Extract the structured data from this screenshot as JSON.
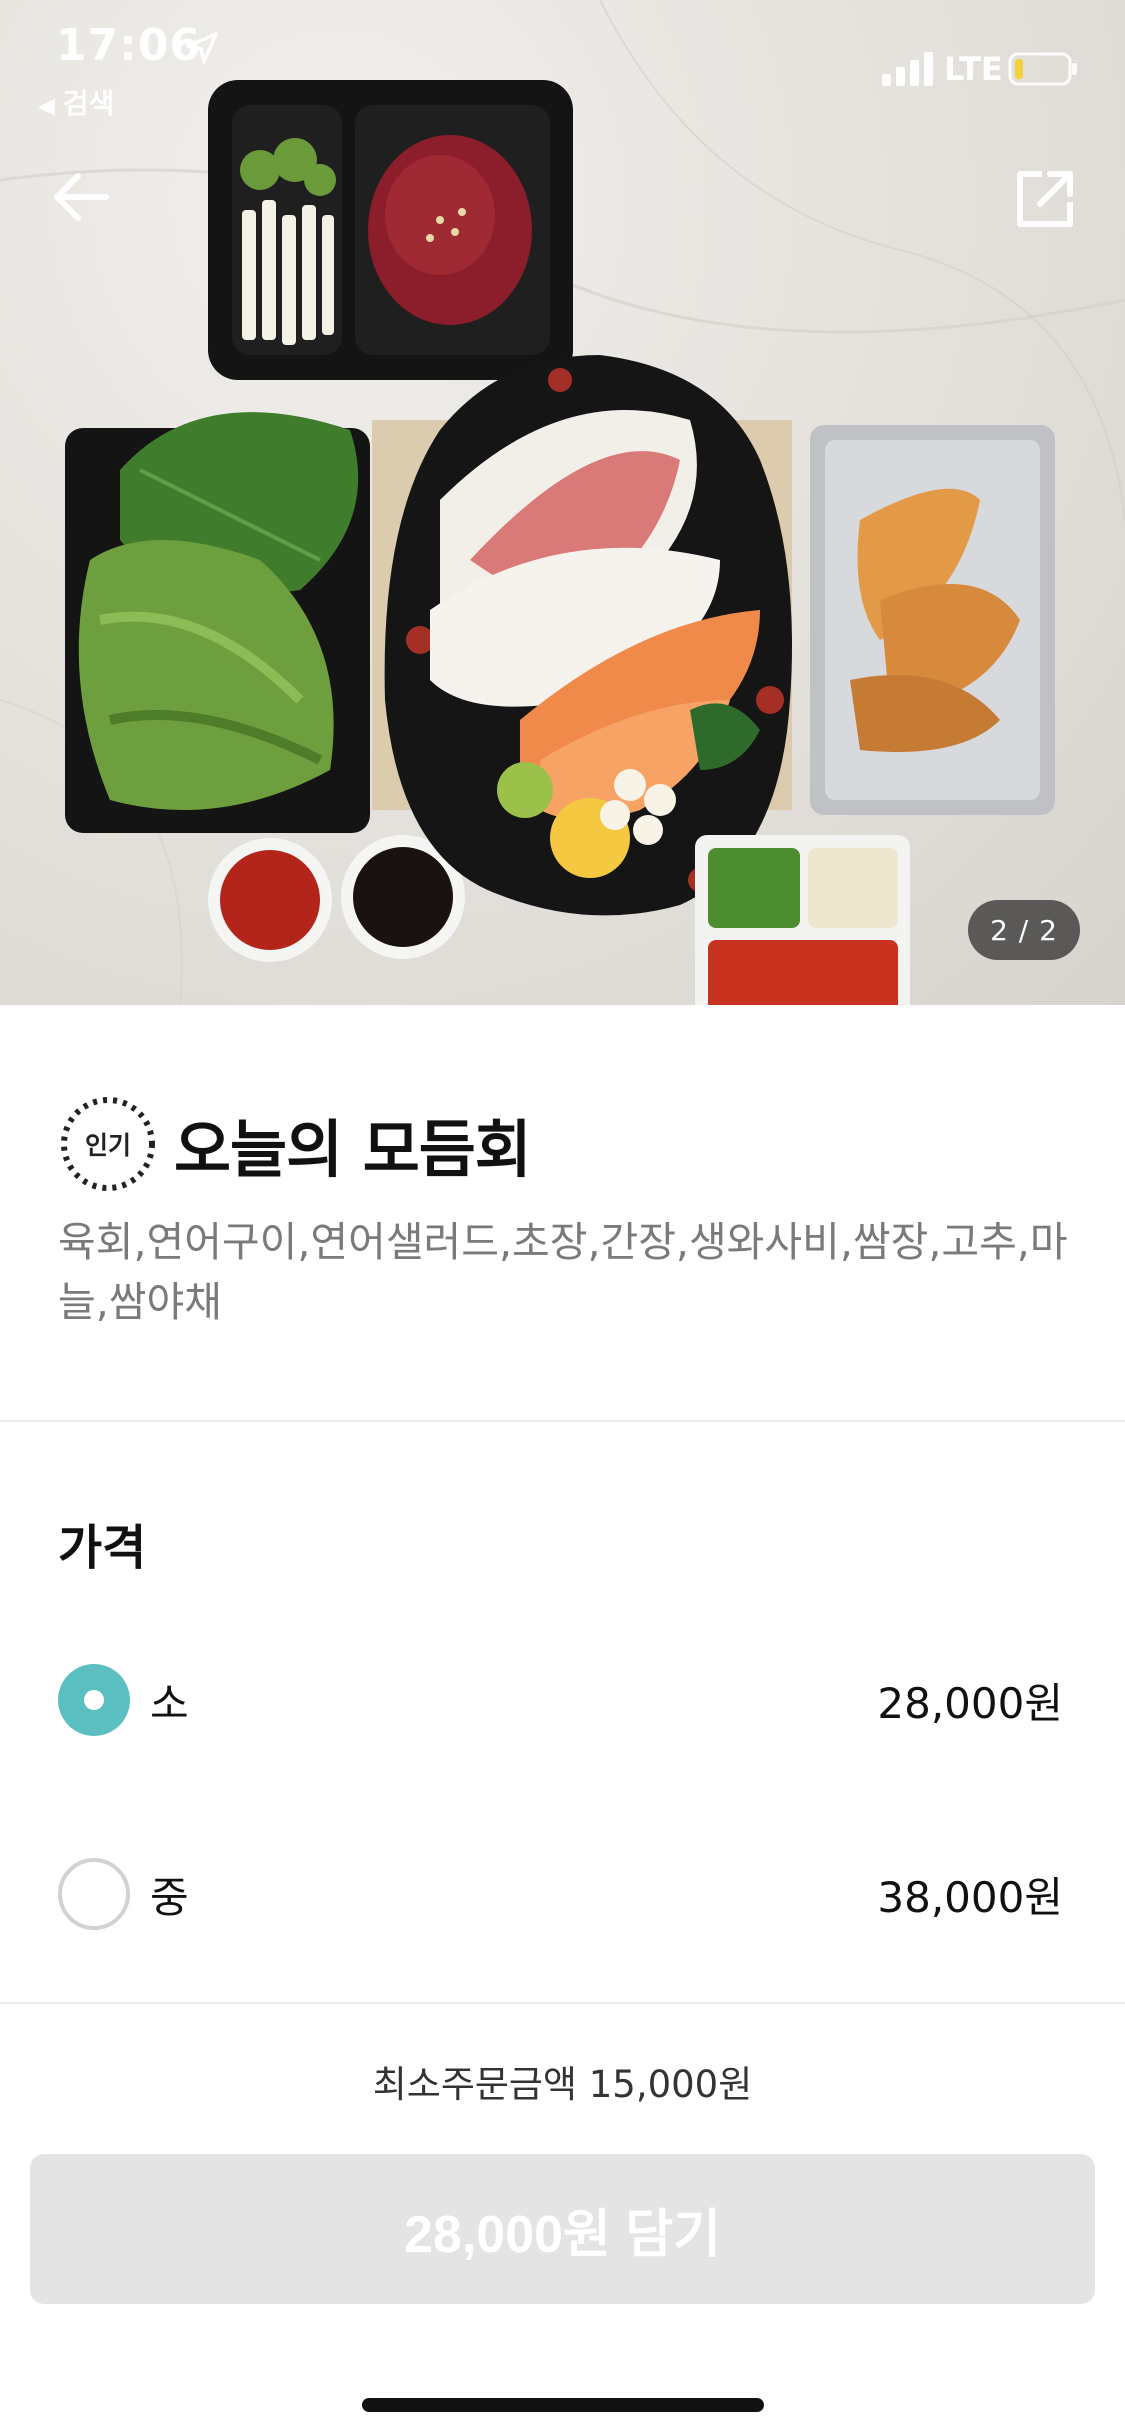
{
  "status_bar": {
    "time": "17:06",
    "back_app": "검색",
    "network": "LTE"
  },
  "hero": {
    "page_indicator": "2 / 2",
    "icons": [
      "back-arrow-icon",
      "share-icon"
    ]
  },
  "menu": {
    "badge": "인기",
    "title": "오늘의 모듬회",
    "description": "육회,연어구이,연어샐러드,초장,간장,생와사비,쌈장,고추,마늘,쌈야채"
  },
  "price_section": {
    "heading": "가격",
    "options": [
      {
        "label": "소",
        "price": "28,000원",
        "selected": true
      },
      {
        "label": "중",
        "price": "38,000원",
        "selected": false
      }
    ]
  },
  "footer": {
    "min_order": "최소주문금액 15,000원",
    "cart_button": "28,000원 담기"
  },
  "colors": {
    "accent": "#5bbfc1",
    "button_disabled": "#e4e4e4",
    "description_text": "#7a7a7a"
  }
}
